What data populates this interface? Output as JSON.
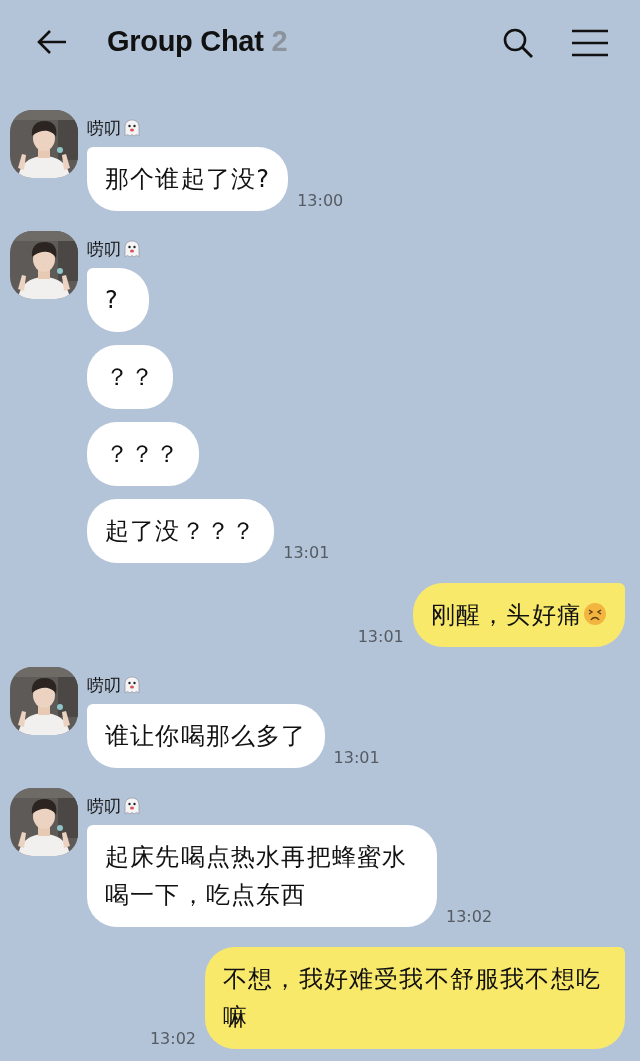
{
  "header": {
    "title": "Group Chat",
    "member_count": "2"
  },
  "messages": [
    {
      "kind": "received",
      "sender": "唠叨",
      "sender_emoji": true,
      "bubbles": [
        {
          "text": "那个谁起了没?",
          "emoji": false
        }
      ],
      "time": "13:00"
    },
    {
      "kind": "received",
      "sender": "唠叨",
      "sender_emoji": true,
      "bubbles": [
        {
          "text": "?",
          "emoji": false
        },
        {
          "text": "？？",
          "emoji": false
        },
        {
          "text": "？？？",
          "emoji": false
        },
        {
          "text": "起了没？？？",
          "emoji": false
        }
      ],
      "time": "13:01"
    },
    {
      "kind": "sent",
      "bubbles": [
        {
          "text": "刚醒，头好痛",
          "emoji": true
        }
      ],
      "time": "13:01"
    },
    {
      "kind": "received",
      "sender": "唠叨",
      "sender_emoji": true,
      "bubbles": [
        {
          "text": "谁让你喝那么多了",
          "emoji": false
        }
      ],
      "time": "13:01"
    },
    {
      "kind": "received",
      "sender": "唠叨",
      "sender_emoji": true,
      "bubbles": [
        {
          "text": "起床先喝点热水再把蜂蜜水喝一下，吃点东西",
          "emoji": false
        }
      ],
      "time": "13:02"
    },
    {
      "kind": "sent",
      "bubbles": [
        {
          "text": "不想，我好难受我不舒服我不想吃嘛",
          "emoji": false
        }
      ],
      "time": "13:02"
    }
  ]
}
